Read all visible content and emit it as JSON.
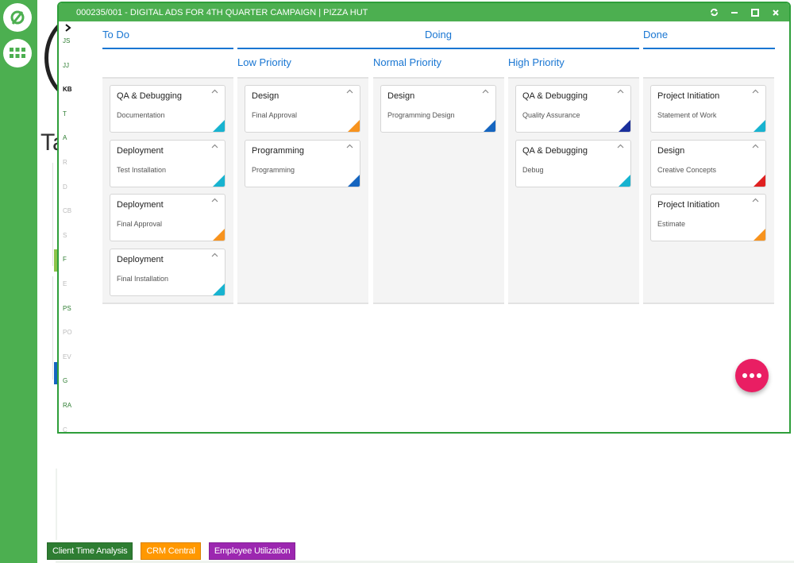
{
  "app": {
    "rail_icons": [
      "app-logo-icon",
      "apps-grid-icon"
    ],
    "background_title_fragment": "Ta"
  },
  "modal": {
    "title": "000235/001 - DIGITAL ADS FOR 4TH QUARTER CAMPAIGN | PIZZA HUT",
    "controls": [
      "refresh",
      "minimize",
      "maximize",
      "close"
    ]
  },
  "letter_rail": {
    "toggle": "›",
    "letters": [
      {
        "label": "JS",
        "state": "active"
      },
      {
        "label": "JJ",
        "state": "active"
      },
      {
        "label": "KB",
        "state": "current"
      },
      {
        "label": "T",
        "state": "active"
      },
      {
        "label": "A",
        "state": "active"
      },
      {
        "label": "R",
        "state": "disabled"
      },
      {
        "label": "D",
        "state": "disabled"
      },
      {
        "label": "CB",
        "state": "disabled"
      },
      {
        "label": "S",
        "state": "disabled"
      },
      {
        "label": "F",
        "state": "active"
      },
      {
        "label": "E",
        "state": "disabled"
      },
      {
        "label": "PS",
        "state": "active"
      },
      {
        "label": "PO",
        "state": "disabled"
      },
      {
        "label": "EV",
        "state": "disabled"
      },
      {
        "label": "G",
        "state": "active"
      },
      {
        "label": "RA",
        "state": "active"
      },
      {
        "label": "C",
        "state": "disabled"
      }
    ]
  },
  "board": {
    "stages": [
      {
        "label": "To Do"
      },
      {
        "label": "Doing"
      },
      {
        "label": "Done"
      }
    ],
    "priorities": [
      "Low Priority",
      "Normal Priority",
      "High Priority"
    ],
    "lanes": [
      {
        "name": "to-do",
        "cards": [
          {
            "title": "QA & Debugging",
            "task": "Documentation",
            "color": "#17b3d0"
          },
          {
            "title": "Deployment",
            "task": "Test Installation",
            "color": "#17b3d0"
          },
          {
            "title": "Deployment",
            "task": "Final Approval",
            "color": "#f7931e"
          },
          {
            "title": "Deployment",
            "task": "Final Installation",
            "color": "#17b3d0"
          }
        ]
      },
      {
        "name": "doing-low",
        "cards": [
          {
            "title": "Design",
            "task": "Final Approval",
            "color": "#f7931e"
          },
          {
            "title": "Programming",
            "task": "Programming",
            "color": "#1565c0"
          }
        ]
      },
      {
        "name": "doing-normal",
        "cards": [
          {
            "title": "Design",
            "task": "Programming Design",
            "color": "#1565c0"
          }
        ]
      },
      {
        "name": "doing-high",
        "cards": [
          {
            "title": "QA & Debugging",
            "task": "Quality Assurance",
            "color": "#1a2f9c"
          },
          {
            "title": "QA & Debugging",
            "task": "Debug",
            "color": "#17b3d0"
          }
        ]
      },
      {
        "name": "done",
        "cards": [
          {
            "title": "Project Initiation",
            "task": "Statement of Work",
            "color": "#17b3d0"
          },
          {
            "title": "Design",
            "task": "Creative Concepts",
            "color": "#e02020"
          },
          {
            "title": "Project Initiation",
            "task": "Estimate",
            "color": "#f7931e"
          }
        ]
      }
    ]
  },
  "fab": {
    "icon": "more-horizontal-icon",
    "color": "#e91e63"
  },
  "shortcuts": [
    {
      "label": "Client Time Analysis",
      "color": "#2e7d32"
    },
    {
      "label": "CRM Central",
      "color": "#ff9800"
    },
    {
      "label": "Employee Utilization",
      "color": "#9c27b0"
    }
  ]
}
